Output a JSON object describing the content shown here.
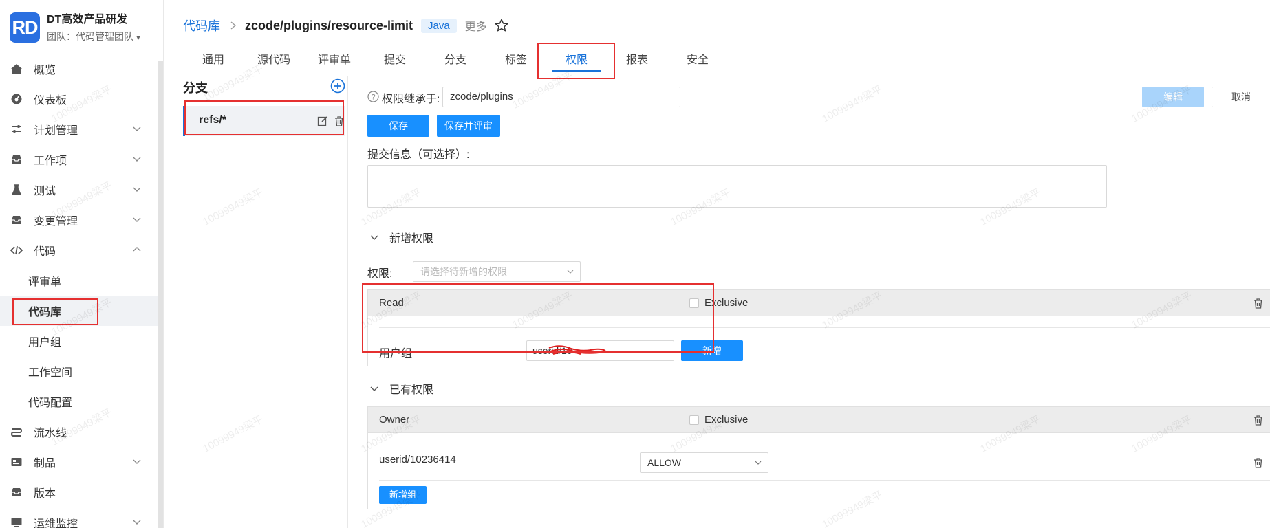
{
  "brand": {
    "logo": "RD",
    "name": "DT高效产品研发",
    "team": "团队：代码管理团队"
  },
  "sidebar": {
    "items": [
      {
        "label": "概览",
        "icon": "home-icon"
      },
      {
        "label": "仪表板",
        "icon": "dashboard-icon"
      },
      {
        "label": "计划管理",
        "icon": "plan-icon",
        "expandable": true
      },
      {
        "label": "工作项",
        "icon": "inbox-icon",
        "expandable": true
      },
      {
        "label": "测试",
        "icon": "flask-icon",
        "expandable": true
      },
      {
        "label": "变更管理",
        "icon": "inbox-icon",
        "expandable": true
      },
      {
        "label": "代码",
        "icon": "code-icon",
        "expanded": true
      }
    ],
    "code_sub": [
      "评审单",
      "代码库",
      "用户组",
      "工作空间",
      "代码配置"
    ],
    "active_sub": "代码库",
    "items_after": [
      {
        "label": "流水线",
        "icon": "pipeline-icon"
      },
      {
        "label": "制品",
        "icon": "package-icon",
        "expandable": true
      },
      {
        "label": "版本",
        "icon": "inbox-icon"
      },
      {
        "label": "运维监控",
        "icon": "monitor-icon",
        "expandable": true
      }
    ]
  },
  "header": {
    "breadcrumb_root": "代码库",
    "repo_path": "zcode/plugins/resource-limit",
    "lang_tag": "Java",
    "more_label": "更多"
  },
  "tabs": [
    "通用",
    "源代码",
    "评审单",
    "提交",
    "分支",
    "标签",
    "权限",
    "报表",
    "安全"
  ],
  "active_tab": "权限",
  "branch_panel": {
    "title": "分支",
    "branch": "refs/*"
  },
  "main": {
    "inherit_label": "权限继承于:",
    "inherit_value": "zcode/plugins",
    "save_label": "保存",
    "save_review_label": "保存并评审",
    "edit_label": "编辑",
    "cancel_label": "取消",
    "commit_label": "提交信息（可选择）:",
    "new_section": "新增权限",
    "perm_label": "权限:",
    "perm_placeholder": "请选择待新增的权限",
    "read_card": {
      "title": "Read",
      "exclusive_label": "Exclusive",
      "group_label": "用户组",
      "group_value": "userid/10",
      "add_label": "新增"
    },
    "existing_section": "已有权限",
    "owner_card": {
      "title": "Owner",
      "exclusive_label": "Exclusive",
      "user": "userid/10236414",
      "user_access": "ALLOW",
      "add_group_label": "新增组"
    }
  },
  "watermark": "10099949梁平",
  "colors": {
    "accent": "#1890ff",
    "link": "#1a73d9",
    "highlight": "#e53030",
    "disabled_btn": "#a9d4fb"
  }
}
